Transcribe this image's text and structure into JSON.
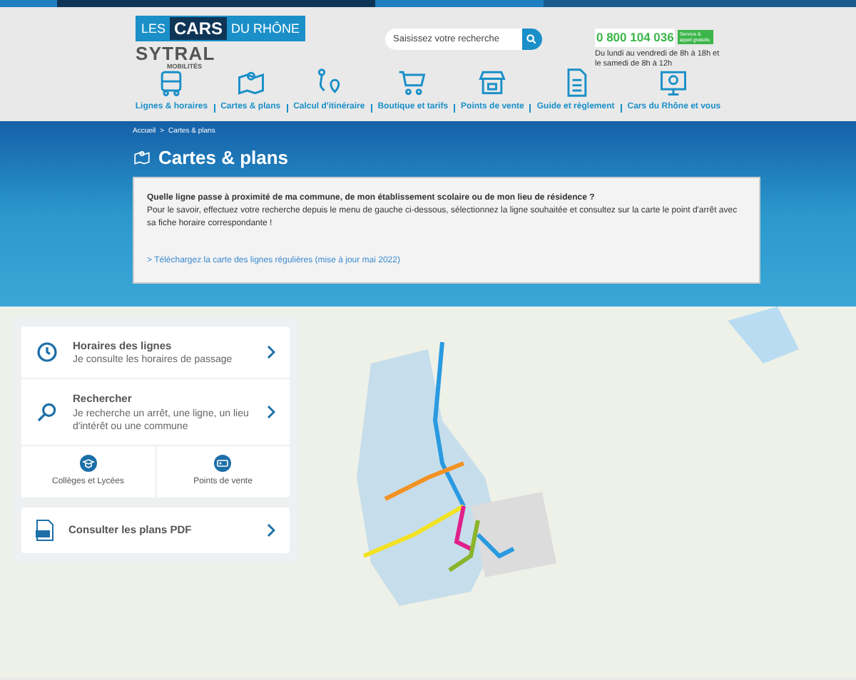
{
  "logo": {
    "part_1": "LES",
    "part_2": "CARS",
    "part_3": "DU RHÔNE",
    "brand": "SYTRAL",
    "brand_sub": "MOBILITÉS"
  },
  "search": {
    "placeholder": "Saisissez votre recherche"
  },
  "contact": {
    "phone": "0 800 104 036",
    "badge": "Service & appel gratuits",
    "hours": "Du lundi au vendredi de 8h à 18h et le samedi de 8h à 12h"
  },
  "nav": [
    {
      "label": "Lignes & horaires",
      "kind": "bus"
    },
    {
      "label": "Cartes & plans",
      "kind": "map"
    },
    {
      "label": "Calcul d'itinéraire",
      "kind": "route"
    },
    {
      "label": "Boutique et tarifs",
      "kind": "cart"
    },
    {
      "label": "Points de vente",
      "kind": "shop"
    },
    {
      "label": "Guide et règlement",
      "kind": "doc"
    },
    {
      "label": "Cars du Rhône et vous",
      "kind": "screen"
    }
  ],
  "breadcrumb": [
    "Accueil",
    ">",
    "Cartes & plans"
  ],
  "page_title": "Cartes & plans",
  "intro": {
    "question": "Quelle ligne passe à proximité de ma commune, de mon établissement scolaire ou de mon lieu de résidence ?",
    "text": "Pour le savoir, effectuez votre recherche depuis le menu de gauche ci-dessous, sélectionnez la ligne souhaitée et consultez sur la carte le point d'arrêt avec sa fiche horaire correspondante !",
    "link": "> Téléchargez la carte des lignes régulières (mise à jour mai 2022)"
  },
  "panel": {
    "items": [
      {
        "kind": "clock",
        "title": "Horaires des lignes",
        "subtitle": "Je consulte les horaires de passage"
      },
      {
        "kind": "search",
        "title": "Rechercher",
        "subtitle": "Je recherche un arrêt, une ligne, un lieu d'intérêt ou une commune"
      }
    ],
    "shortcuts": [
      {
        "kind": "school",
        "label": "Collèges et Lycées"
      },
      {
        "kind": "ticket",
        "label": "Points de vente"
      }
    ],
    "pdf": "Consulter les plans PDF"
  }
}
